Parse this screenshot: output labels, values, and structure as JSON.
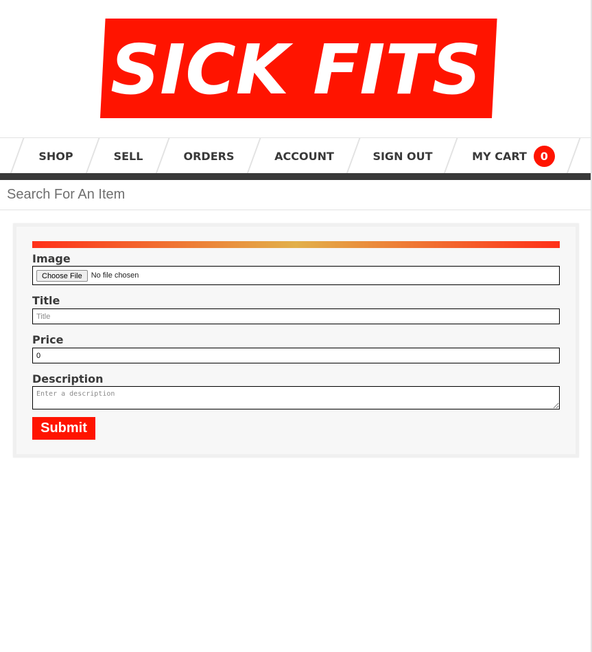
{
  "brand": {
    "logo_text": "SICK FITS",
    "accent_color": "#ff1400",
    "dark_color": "#393939"
  },
  "nav": {
    "items": [
      {
        "label": "SHOP"
      },
      {
        "label": "SELL"
      },
      {
        "label": "ORDERS"
      },
      {
        "label": "ACCOUNT"
      },
      {
        "label": "SIGN OUT"
      },
      {
        "label": "MY CART"
      }
    ],
    "cart_count": "0"
  },
  "search": {
    "placeholder": "Search For An Item"
  },
  "form": {
    "image_label": "Image",
    "file_button_label": "Choose File",
    "file_status": "No file chosen",
    "title_label": "Title",
    "title_placeholder": "Title",
    "title_value": "",
    "price_label": "Price",
    "price_value": "0",
    "description_label": "Description",
    "description_placeholder": "Enter a description",
    "submit_label": "Submit"
  }
}
